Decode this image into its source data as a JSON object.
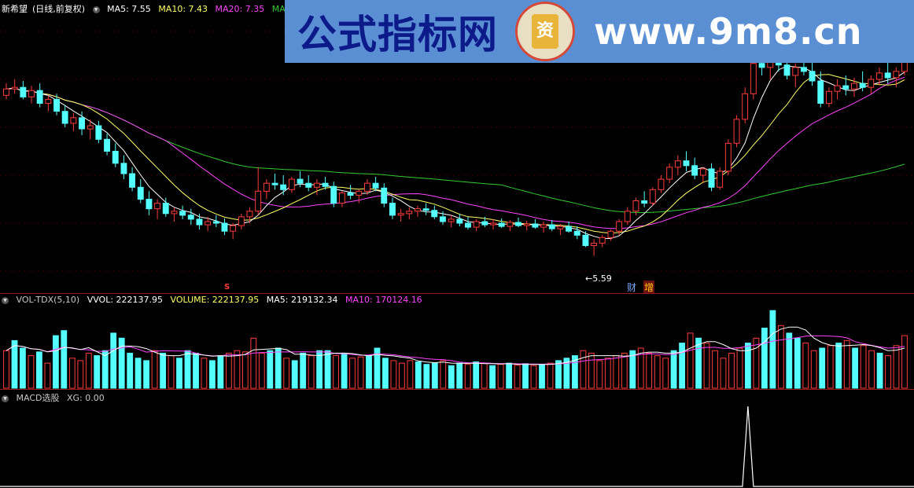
{
  "price_header": {
    "stock_name": "新希望",
    "mode": "(日线,前复权)",
    "ma5_label": "MA5: 7.55",
    "ma10_label": "MA10: 7.43",
    "ma20_label": "MA20: 7.35",
    "ma60_label": "MA60: 6."
  },
  "price_annotations": {
    "low_marker": "5.59",
    "badge_cai": "财",
    "badge_zeng": "增",
    "s_mark": "S"
  },
  "volume_header": {
    "indicator": "VOL-TDX(5,10)",
    "vvol": "VVOL: 222137.95",
    "volume": "VOLUME: 222137.95",
    "ma5": "MA5: 219132.34",
    "ma10": "MA10: 170124.16"
  },
  "macd_header": {
    "indicator": "MACD选股",
    "xg": "XG: 0.00"
  },
  "watermark": {
    "cn_text": "公式指标网",
    "logo_char": "资",
    "url": "www.9m8.cn"
  },
  "colors": {
    "up": "#ff3b3b",
    "down": "#54ffff",
    "ma5": "#ffffff",
    "ma10": "#ffff66",
    "ma20": "#ff44ff",
    "ma60": "#33cc33",
    "vol_ma10": "#ff44ff",
    "vol_ma5": "#ffffff",
    "macd": "#ffffff"
  },
  "chart_data": [
    {
      "type": "candlestick",
      "title": "新希望(日线,前复权)",
      "y_low_label": 5.59,
      "ohlc": [
        [
          7.6,
          7.75,
          7.55,
          7.68
        ],
        [
          7.68,
          7.8,
          7.62,
          7.7
        ],
        [
          7.7,
          7.78,
          7.55,
          7.58
        ],
        [
          7.58,
          7.72,
          7.5,
          7.66
        ],
        [
          7.66,
          7.75,
          7.45,
          7.5
        ],
        [
          7.5,
          7.6,
          7.4,
          7.55
        ],
        [
          7.55,
          7.62,
          7.35,
          7.4
        ],
        [
          7.4,
          7.48,
          7.2,
          7.25
        ],
        [
          7.25,
          7.38,
          7.15,
          7.32
        ],
        [
          7.32,
          7.4,
          7.1,
          7.18
        ],
        [
          7.18,
          7.3,
          7.05,
          7.22
        ],
        [
          7.22,
          7.28,
          7.0,
          7.05
        ],
        [
          7.05,
          7.12,
          6.85,
          6.9
        ],
        [
          6.9,
          7.0,
          6.7,
          6.75
        ],
        [
          6.75,
          6.85,
          6.55,
          6.62
        ],
        [
          6.62,
          6.7,
          6.4,
          6.45
        ],
        [
          6.45,
          6.55,
          6.25,
          6.3
        ],
        [
          6.3,
          6.4,
          6.1,
          6.18
        ],
        [
          6.18,
          6.3,
          6.05,
          6.25
        ],
        [
          6.25,
          6.32,
          6.08,
          6.12
        ],
        [
          6.12,
          6.2,
          6.02,
          6.15
        ],
        [
          6.15,
          6.22,
          6.05,
          6.1
        ],
        [
          6.1,
          6.18,
          5.98,
          6.05
        ],
        [
          6.05,
          6.12,
          5.92,
          5.98
        ],
        [
          5.98,
          6.08,
          5.9,
          6.02
        ],
        [
          6.02,
          6.1,
          5.95,
          6.0
        ],
        [
          6.0,
          6.06,
          5.85,
          5.9
        ],
        [
          5.9,
          6.0,
          5.8,
          5.97
        ],
        [
          5.97,
          6.12,
          5.92,
          6.08
        ],
        [
          6.08,
          6.2,
          6.0,
          6.15
        ],
        [
          6.15,
          6.7,
          6.1,
          6.4
        ],
        [
          6.4,
          6.55,
          6.3,
          6.5
        ],
        [
          6.5,
          6.62,
          6.42,
          6.48
        ],
        [
          6.48,
          6.6,
          6.35,
          6.42
        ],
        [
          6.42,
          6.58,
          6.38,
          6.55
        ],
        [
          6.55,
          6.65,
          6.45,
          6.5
        ],
        [
          6.5,
          6.6,
          6.4,
          6.45
        ],
        [
          6.45,
          6.55,
          6.35,
          6.5
        ],
        [
          6.5,
          6.58,
          6.42,
          6.46
        ],
        [
          6.46,
          6.52,
          6.2,
          6.25
        ],
        [
          6.25,
          6.4,
          6.2,
          6.38
        ],
        [
          6.38,
          6.48,
          6.3,
          6.35
        ],
        [
          6.35,
          6.42,
          6.25,
          6.4
        ],
        [
          6.4,
          6.55,
          6.35,
          6.5
        ],
        [
          6.5,
          6.58,
          6.4,
          6.44
        ],
        [
          6.44,
          6.5,
          6.2,
          6.25
        ],
        [
          6.25,
          6.32,
          6.05,
          6.1
        ],
        [
          6.1,
          6.18,
          6.02,
          6.12
        ],
        [
          6.12,
          6.2,
          6.05,
          6.15
        ],
        [
          6.15,
          6.22,
          6.08,
          6.18
        ],
        [
          6.18,
          6.25,
          6.1,
          6.16
        ],
        [
          6.16,
          6.22,
          6.05,
          6.08
        ],
        [
          6.08,
          6.15,
          5.98,
          6.02
        ],
        [
          6.02,
          6.1,
          5.95,
          6.05
        ],
        [
          6.05,
          6.12,
          5.96,
          6.0
        ],
        [
          6.0,
          6.08,
          5.92,
          5.95
        ],
        [
          5.95,
          6.05,
          5.9,
          6.02
        ],
        [
          6.02,
          6.08,
          5.95,
          5.98
        ],
        [
          5.98,
          6.05,
          5.92,
          6.0
        ],
        [
          6.0,
          6.06,
          5.94,
          5.96
        ],
        [
          5.96,
          6.04,
          5.9,
          6.01
        ],
        [
          6.01,
          6.07,
          5.95,
          5.97
        ],
        [
          5.97,
          6.03,
          5.91,
          5.99
        ],
        [
          5.99,
          6.05,
          5.93,
          5.95
        ],
        [
          5.95,
          6.02,
          5.88,
          5.98
        ],
        [
          5.98,
          6.04,
          5.9,
          5.93
        ],
        [
          5.93,
          5.99,
          5.85,
          5.96
        ],
        [
          5.96,
          6.02,
          5.88,
          5.9
        ],
        [
          5.9,
          5.96,
          5.8,
          5.85
        ],
        [
          5.85,
          5.9,
          5.7,
          5.72
        ],
        [
          5.72,
          5.8,
          5.59,
          5.75
        ],
        [
          5.75,
          5.85,
          5.7,
          5.82
        ],
        [
          5.82,
          5.92,
          5.78,
          5.9
        ],
        [
          5.9,
          6.05,
          5.85,
          6.02
        ],
        [
          6.02,
          6.2,
          5.98,
          6.15
        ],
        [
          6.15,
          6.32,
          6.1,
          6.28
        ],
        [
          6.28,
          6.4,
          6.2,
          6.25
        ],
        [
          6.25,
          6.45,
          6.22,
          6.42
        ],
        [
          6.42,
          6.6,
          6.38,
          6.55
        ],
        [
          6.55,
          6.75,
          6.5,
          6.7
        ],
        [
          6.7,
          6.85,
          6.6,
          6.78
        ],
        [
          6.78,
          6.9,
          6.65,
          6.72
        ],
        [
          6.72,
          6.82,
          6.55,
          6.6
        ],
        [
          6.6,
          6.7,
          6.5,
          6.68
        ],
        [
          6.68,
          6.75,
          6.4,
          6.45
        ],
        [
          6.45,
          6.7,
          6.42,
          6.65
        ],
        [
          6.65,
          7.05,
          6.6,
          7.0
        ],
        [
          7.0,
          7.35,
          6.95,
          7.3
        ],
        [
          7.3,
          7.7,
          7.25,
          7.62
        ],
        [
          7.62,
          8.1,
          7.55,
          8.0
        ],
        [
          8.0,
          8.2,
          7.85,
          7.95
        ],
        [
          7.95,
          8.15,
          7.8,
          8.05
        ],
        [
          8.05,
          8.2,
          7.9,
          7.98
        ],
        [
          7.98,
          8.12,
          7.8,
          7.85
        ],
        [
          7.85,
          8.0,
          7.7,
          7.95
        ],
        [
          7.95,
          8.1,
          7.85,
          7.9
        ],
        [
          7.9,
          8.05,
          7.72,
          7.78
        ],
        [
          7.78,
          7.9,
          7.45,
          7.5
        ],
        [
          7.5,
          7.7,
          7.45,
          7.65
        ],
        [
          7.65,
          7.8,
          7.55,
          7.72
        ],
        [
          7.72,
          7.85,
          7.6,
          7.68
        ],
        [
          7.68,
          7.82,
          7.58,
          7.75
        ],
        [
          7.75,
          7.9,
          7.65,
          7.7
        ],
        [
          7.7,
          7.85,
          7.62,
          7.8
        ],
        [
          7.8,
          7.95,
          7.72,
          7.88
        ],
        [
          7.88,
          8.02,
          7.75,
          7.82
        ],
        [
          7.82,
          7.95,
          7.7,
          7.9
        ],
        [
          7.9,
          8.1,
          7.85,
          8.05
        ]
      ],
      "ma_lines": [
        {
          "name": "MA5",
          "last": 7.55
        },
        {
          "name": "MA10",
          "last": 7.43
        },
        {
          "name": "MA20",
          "last": 7.35
        },
        {
          "name": "MA60",
          "last": 6.0
        }
      ]
    },
    {
      "type": "bar",
      "title": "VOL-TDX(5,10)",
      "ma5_last": 219132.34,
      "ma10_last": 170124.16,
      "last_volume": 222137.95,
      "values": [
        150,
        190,
        160,
        130,
        145,
        100,
        210,
        230,
        120,
        110,
        140,
        130,
        150,
        220,
        200,
        140,
        120,
        110,
        150,
        140,
        130,
        120,
        150,
        140,
        120,
        110,
        130,
        140,
        150,
        145,
        200,
        140,
        150,
        160,
        120,
        110,
        140,
        130,
        150,
        150,
        130,
        140,
        120,
        125,
        130,
        160,
        120,
        110,
        100,
        110,
        105,
        95,
        100,
        110,
        90,
        100,
        95,
        105,
        100,
        90,
        95,
        100,
        92,
        98,
        90,
        95,
        100,
        110,
        120,
        130,
        150,
        140,
        110,
        120,
        130,
        140,
        150,
        160,
        140,
        130,
        120,
        150,
        180,
        220,
        200,
        180,
        150,
        120,
        140,
        160,
        180,
        200,
        240,
        310,
        250,
        220,
        200,
        180,
        150,
        160,
        170,
        180,
        190,
        160,
        170,
        150,
        140,
        130,
        170,
        210
      ],
      "up_flags": [
        1,
        0,
        0,
        1,
        0,
        1,
        0,
        0,
        1,
        1,
        1,
        0,
        0,
        0,
        0,
        0,
        0,
        0,
        1,
        0,
        1,
        0,
        0,
        0,
        1,
        0,
        0,
        1,
        1,
        1,
        1,
        1,
        0,
        0,
        1,
        0,
        0,
        1,
        0,
        0,
        1,
        0,
        1,
        1,
        0,
        0,
        0,
        1,
        1,
        1,
        0,
        0,
        0,
        1,
        0,
        0,
        1,
        0,
        1,
        0,
        1,
        0,
        1,
        0,
        1,
        0,
        1,
        0,
        0,
        0,
        1,
        1,
        1,
        1,
        1,
        1,
        0,
        1,
        1,
        1,
        1,
        0,
        0,
        1,
        0,
        1,
        1,
        1,
        1,
        1,
        0,
        1,
        0,
        0,
        1,
        0,
        0,
        1,
        1,
        0,
        1,
        0,
        1,
        0,
        1,
        1,
        0,
        1,
        1,
        1
      ]
    },
    {
      "type": "line",
      "title": "MACD选股",
      "xg_last": 0.0,
      "spike_index": 90,
      "values_desc": "signal is 0 everywhere except a single spike to 1 at spike_index"
    }
  ]
}
